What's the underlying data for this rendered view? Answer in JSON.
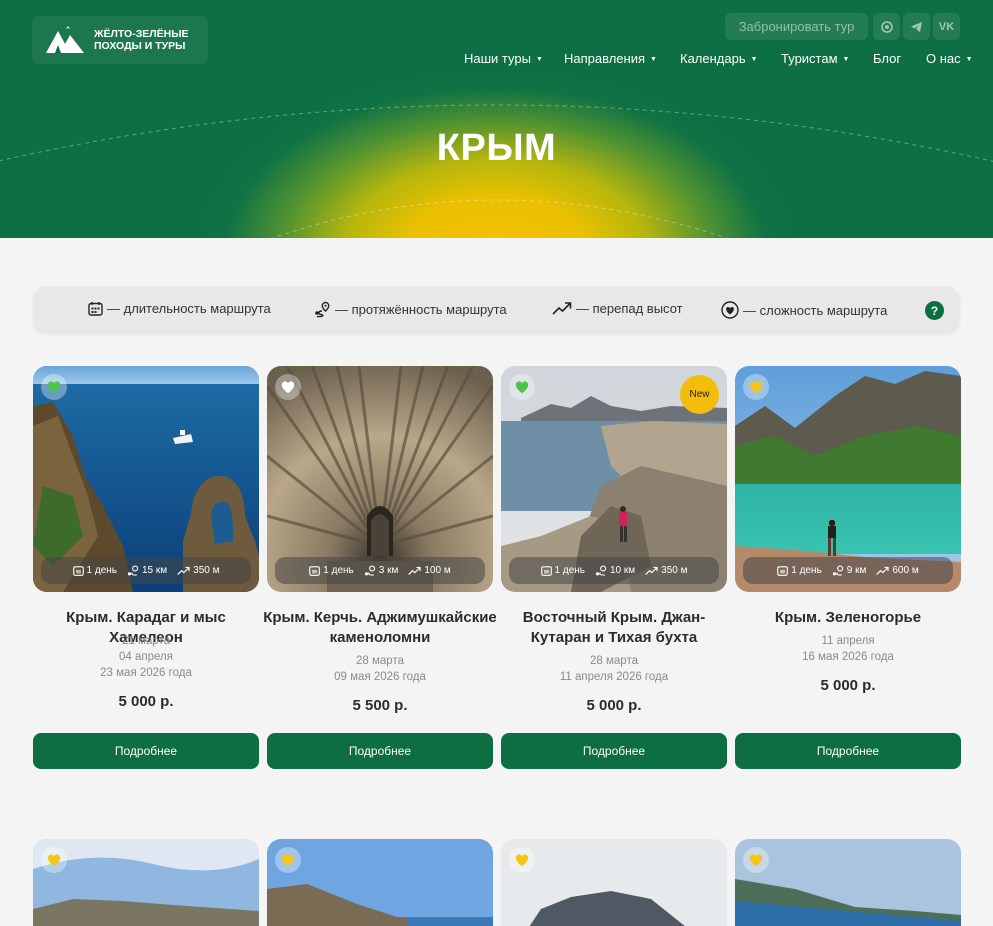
{
  "logo": {
    "line1": "ЖЁЛТО-ЗЕЛЁНЫЕ",
    "line2": "ПОХОДЫ И ТУРЫ"
  },
  "header": {
    "book_label": "Забронировать тур",
    "social": [
      "whatsapp-icon",
      "telegram-icon",
      "vk-icon"
    ],
    "vk_text": "VK",
    "nav": [
      {
        "label": "Наши туры",
        "dropdown": true
      },
      {
        "label": "Направления",
        "dropdown": true
      },
      {
        "label": "Календарь",
        "dropdown": true
      },
      {
        "label": "Туристам",
        "dropdown": true
      },
      {
        "label": "Блог",
        "dropdown": false
      },
      {
        "label": "О нас",
        "dropdown": true
      }
    ]
  },
  "page_title": "КРЫМ",
  "legend": {
    "duration": "— длительность маршрута",
    "distance": "— протяжённость маршрута",
    "elevation": "— перепад высот",
    "difficulty": "— сложность маршрута",
    "help": "?"
  },
  "colors": {
    "brand_green": "#0d6e42",
    "accent_yellow": "#f5c100",
    "heart_green": "#4cc34a",
    "heart_yellow": "#f5c518",
    "heart_white": "#ffffff"
  },
  "tours": [
    {
      "title": "Крым. Карадаг и мыс Хамелеон",
      "dates": [
        "21 марта",
        "04 апреля",
        "23 мая 2026 года"
      ],
      "price": "5 000 р.",
      "days": "1 день",
      "distance": "15 км",
      "elevation": "350 м",
      "difficulty": "green",
      "new": false,
      "button": "Подробнее"
    },
    {
      "title": "Крым. Керчь. Аджимушкайские каменоломни",
      "dates": [
        "28 марта",
        "09 мая 2026 года"
      ],
      "price": "5 500 р.",
      "days": "1 день",
      "distance": "3 км",
      "elevation": "100 м",
      "difficulty": "white",
      "new": false,
      "button": "Подробнее"
    },
    {
      "title": "Восточный Крым. Джан-Кутаран и Тихая бухта",
      "dates": [
        "28 марта",
        "11 апреля 2026 года"
      ],
      "price": "5 000 р.",
      "days": "1 день",
      "distance": "10 км",
      "elevation": "350 м",
      "difficulty": "green",
      "new": true,
      "new_label": "New",
      "button": "Подробнее"
    },
    {
      "title": "Крым. Зеленогорье",
      "dates": [
        "11 апреля",
        "16 мая 2026 года"
      ],
      "price": "5 000 р.",
      "days": "1 день",
      "distance": "9 км",
      "elevation": "600 м",
      "difficulty": "yellow",
      "new": false,
      "button": "Подробнее"
    }
  ],
  "row2_difficulty": [
    "yellow",
    "yellow",
    "yellow",
    "yellow"
  ]
}
